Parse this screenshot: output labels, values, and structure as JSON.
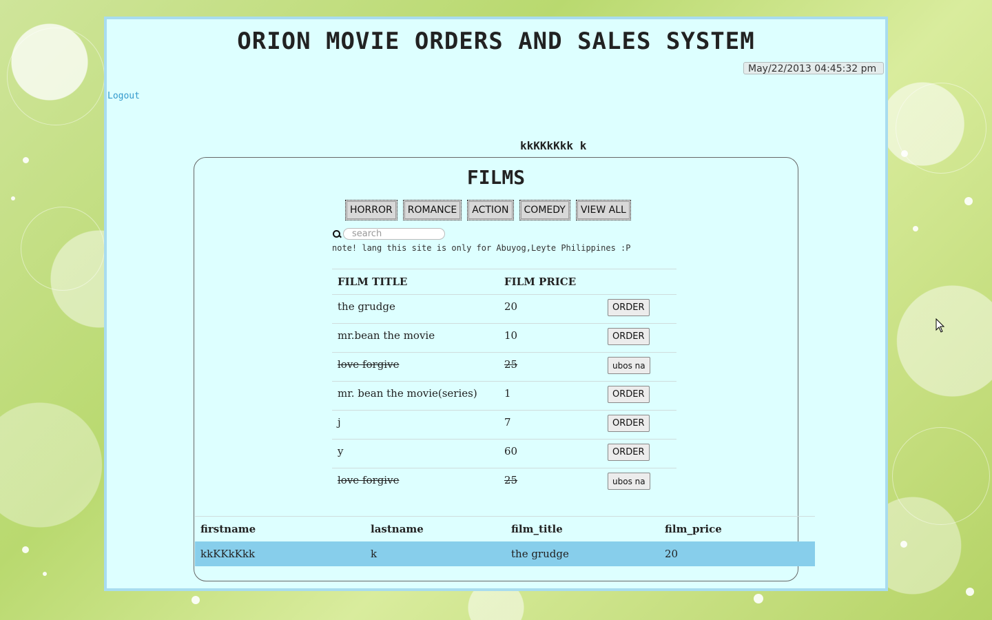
{
  "header": {
    "title": "ORION MOVIE ORDERS AND SALES SYSTEM",
    "datetime": "May/22/2013 04:45:32 pm",
    "logout_label": "Logout"
  },
  "user": {
    "display_name": "kkKKkKkk k"
  },
  "films": {
    "heading": "FILMS",
    "genres": [
      "HORROR",
      "ROMANCE",
      "ACTION",
      "COMEDY",
      "VIEW ALL"
    ],
    "search": {
      "placeholder": "search",
      "value": ""
    },
    "note": "note! lang this site is only for Abuyog,Leyte Philippines :P",
    "columns": [
      "FILM TITLE",
      "FILM PRICE"
    ],
    "rows": [
      {
        "title": "the grudge",
        "price": "20",
        "action": "ORDER",
        "unavailable": false
      },
      {
        "title": "mr.bean the movie",
        "price": "10",
        "action": "ORDER",
        "unavailable": false
      },
      {
        "title": "love forgive",
        "price": "25",
        "action": "ubos na",
        "unavailable": true
      },
      {
        "title": "mr. bean the movie(series)",
        "price": "1",
        "action": "ORDER",
        "unavailable": false
      },
      {
        "title": "j",
        "price": "7",
        "action": "ORDER",
        "unavailable": false
      },
      {
        "title": "y",
        "price": "60",
        "action": "ORDER",
        "unavailable": false
      },
      {
        "title": "love forgive",
        "price": "25",
        "action": "ubos na",
        "unavailable": true
      }
    ]
  },
  "orders": {
    "columns": [
      "firstname",
      "lastname",
      "film_title",
      "film_price"
    ],
    "rows": [
      [
        "kkKKkKkk",
        "k",
        "the grudge",
        "20"
      ]
    ]
  },
  "colors": {
    "container_bg": "#ddffff",
    "container_border": "#a8dcef",
    "selected_row": "#87ceeb",
    "link": "#3399cc"
  }
}
